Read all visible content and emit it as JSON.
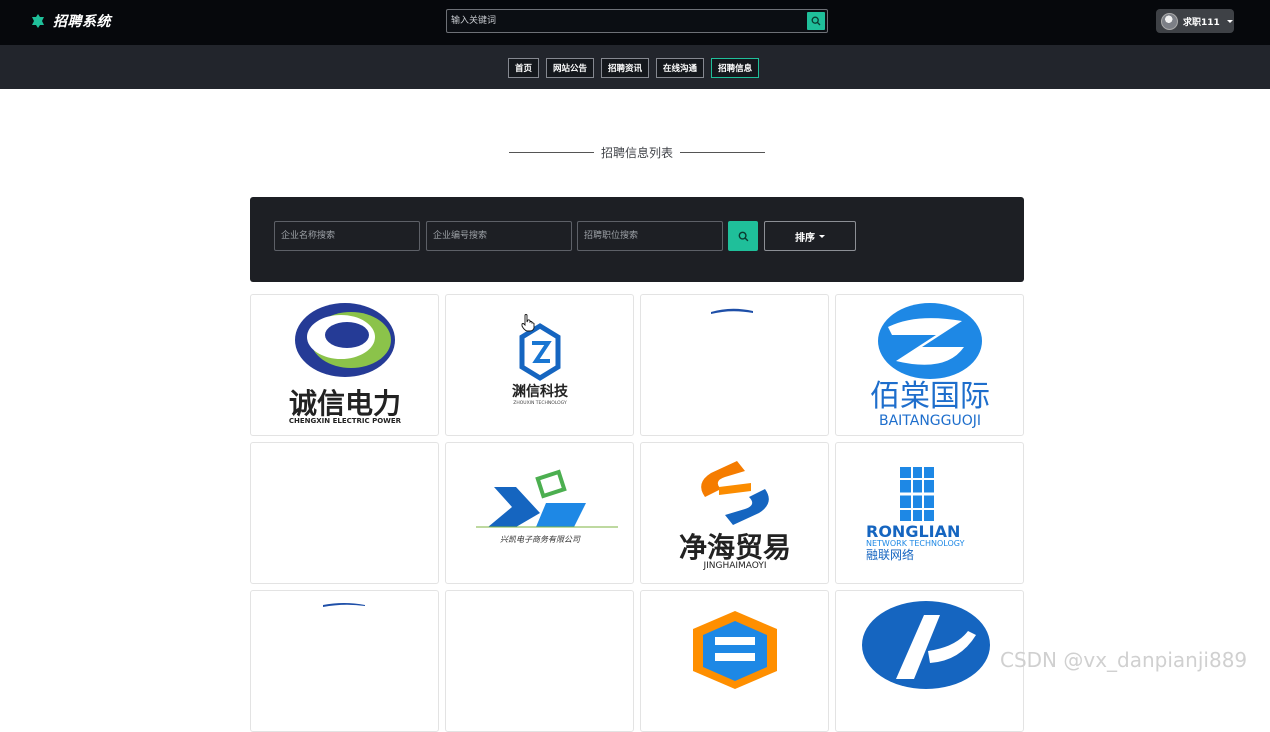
{
  "app": {
    "title": "招聘系统"
  },
  "header": {
    "search_placeholder": "输入关键词",
    "user_name": "求职111"
  },
  "nav": {
    "items": [
      {
        "label": "首页",
        "active": false
      },
      {
        "label": "网站公告",
        "active": false
      },
      {
        "label": "招聘资讯",
        "active": false
      },
      {
        "label": "在线沟通",
        "active": false
      },
      {
        "label": "招聘信息",
        "active": true
      }
    ]
  },
  "section": {
    "title": "招聘信息列表"
  },
  "filters": {
    "company_name_placeholder": "企业名称搜索",
    "company_code_placeholder": "企业编号搜索",
    "position_placeholder": "招聘职位搜索",
    "sort_label": "排序"
  },
  "cards": [
    {
      "name_cn": "诚信电力",
      "name_en": "CHENGXIN ELECTRIC POWER"
    },
    {
      "name_cn": "渊信科技",
      "name_en": "ZHOUXIN TECHNOLOGY"
    },
    {
      "name_cn": "",
      "name_en": ""
    },
    {
      "name_cn": "佰棠国际",
      "name_en": "BAITANGGUOJI"
    },
    {
      "name_cn": "",
      "name_en": ""
    },
    {
      "name_cn": "兴凯电子商务有限公司",
      "name_en": ""
    },
    {
      "name_cn": "净海贸易",
      "name_en": "JINGHAIMAOYI"
    },
    {
      "name_cn": "融联网络",
      "name_en": "RONGLIAN",
      "sub_en": "NETWORK TECHNOLOGY"
    },
    {
      "name_cn": "",
      "name_en": ""
    },
    {
      "name_cn": "",
      "name_en": ""
    },
    {
      "name_cn": "",
      "name_en": ""
    },
    {
      "name_cn": "",
      "name_en": ""
    }
  ],
  "colors": {
    "accent": "#1fbf9a",
    "header_bg": "#06080c",
    "nav_bg": "#22252c",
    "panel_bg": "#1d1f24"
  },
  "watermark": "CSDN @vx_danpianji889"
}
